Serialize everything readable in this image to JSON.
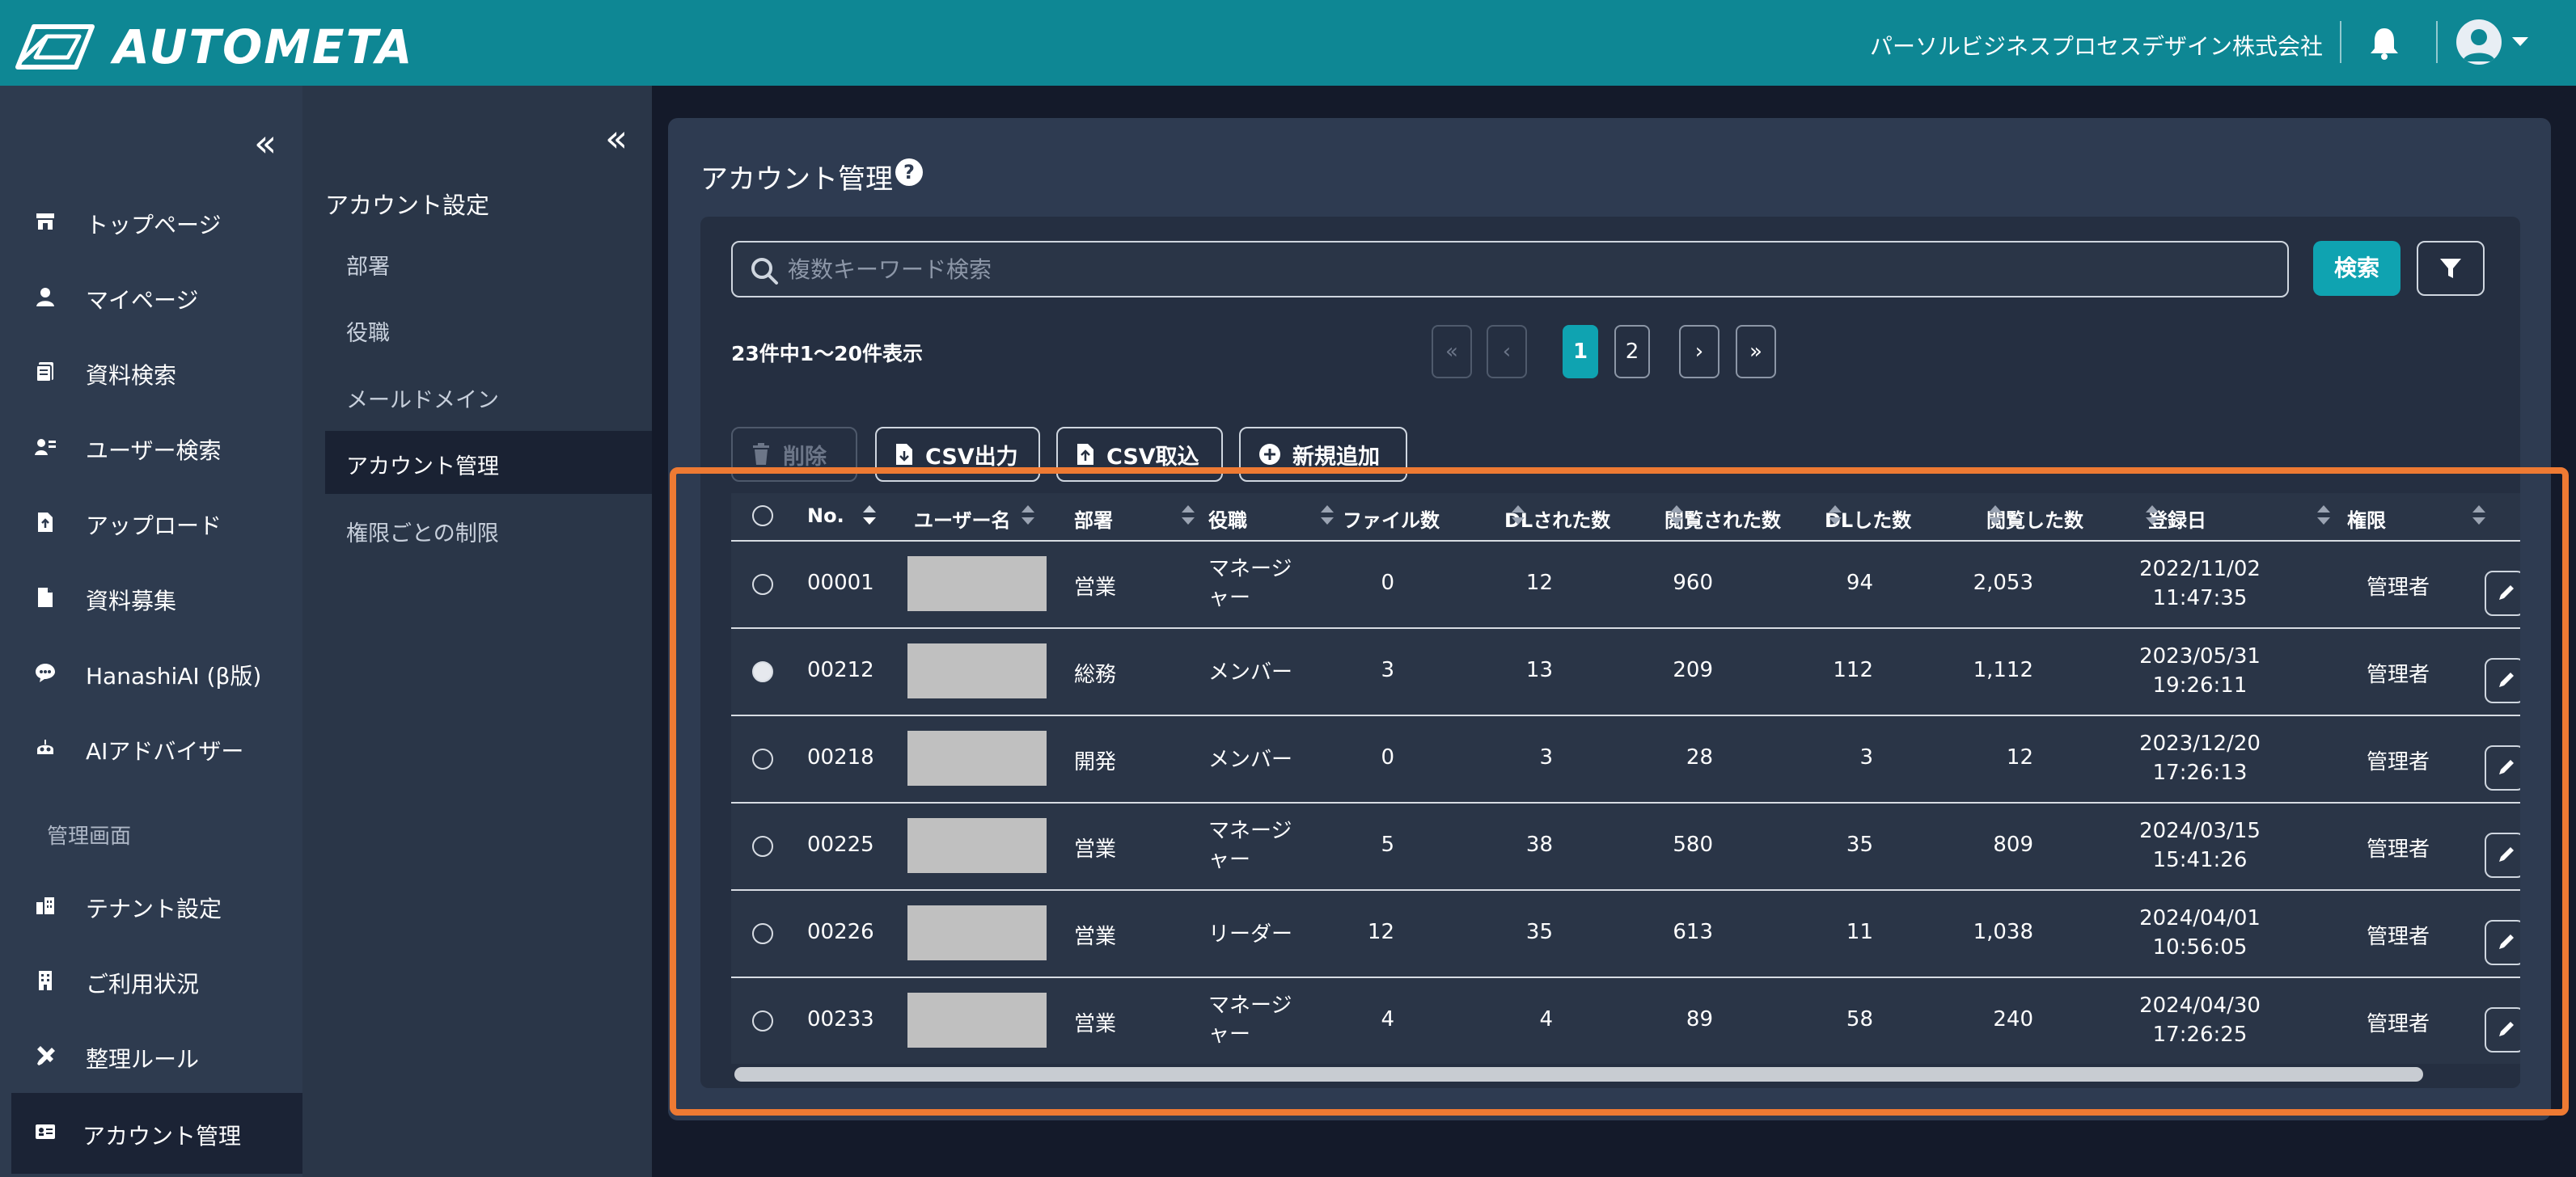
{
  "brand": {
    "name": "AUTOMETA",
    "icon": "autometa-logo-icon"
  },
  "header": {
    "company": "パーソルビジネスプロセスデザイン株式会社",
    "icons": [
      "bell-icon",
      "user-avatar-icon",
      "caret-down-icon"
    ]
  },
  "sidebar": {
    "collapse": "«",
    "items": [
      {
        "label": "トップページ",
        "icon": "store-icon"
      },
      {
        "label": "マイページ",
        "icon": "person-icon"
      },
      {
        "label": "資料検索",
        "icon": "documents-icon"
      },
      {
        "label": "ユーザー検索",
        "icon": "user-search-icon"
      },
      {
        "label": "アップロード",
        "icon": "file-upload-icon"
      },
      {
        "label": "資料募集",
        "icon": "file-icon"
      },
      {
        "label": "HanashiAI (β版)",
        "icon": "chat-icon"
      },
      {
        "label": "AIアドバイザー",
        "icon": "robot-icon"
      }
    ],
    "admin_section": "管理画面",
    "admin_items": [
      {
        "label": "テナント設定",
        "icon": "building-icon"
      },
      {
        "label": "ご利用状況",
        "icon": "office-icon"
      },
      {
        "label": "整理ルール",
        "icon": "tools-icon"
      },
      {
        "label": "アカウント管理",
        "icon": "id-card-icon",
        "active": true
      }
    ]
  },
  "subsidebar": {
    "collapse": "«",
    "title": "アカウント設定",
    "items": [
      {
        "label": "部署"
      },
      {
        "label": "役職"
      },
      {
        "label": "メールドメイン"
      },
      {
        "label": "アカウント管理",
        "active": true
      },
      {
        "label": "権限ごとの制限"
      }
    ]
  },
  "main": {
    "title": "アカウント管理",
    "help": "?",
    "search": {
      "placeholder": "複数キーワード検索",
      "value": ""
    },
    "search_button": "検索",
    "count_text": "23件中1〜20件表示",
    "pagination": {
      "first": "«",
      "prev": "‹",
      "pages": [
        "1",
        "2"
      ],
      "current": "1",
      "next": "›",
      "last": "»"
    },
    "actions": {
      "delete": "削除",
      "csv_export": "CSV出力",
      "csv_import": "CSV取込",
      "add_new": "新規追加"
    },
    "table": {
      "headers": [
        "No.",
        "ユーザー名",
        "部署",
        "役職",
        "ファイル数",
        "DLされた数",
        "閲覧された数",
        "DLした数",
        "閲覧した数",
        "登録日",
        "権限"
      ],
      "rows": [
        {
          "no": "00001",
          "dept": "営業",
          "role1": "マネージ",
          "role2": "ャー",
          "files": "0",
          "dl_by": "12",
          "viewed_by": "960",
          "dl": "94",
          "viewed": "2,053",
          "date": "2022/11/02",
          "time": "11:47:35",
          "auth": "管理者",
          "checked": false
        },
        {
          "no": "00212",
          "dept": "総務",
          "role1": "メンバー",
          "role2": "",
          "files": "3",
          "dl_by": "13",
          "viewed_by": "209",
          "dl": "112",
          "viewed": "1,112",
          "date": "2023/05/31",
          "time": "19:26:11",
          "auth": "管理者",
          "checked": true
        },
        {
          "no": "00218",
          "dept": "開発",
          "role1": "メンバー",
          "role2": "",
          "files": "0",
          "dl_by": "3",
          "viewed_by": "28",
          "dl": "3",
          "viewed": "12",
          "date": "2023/12/20",
          "time": "17:26:13",
          "auth": "管理者",
          "checked": false
        },
        {
          "no": "00225",
          "dept": "営業",
          "role1": "マネージ",
          "role2": "ャー",
          "files": "5",
          "dl_by": "38",
          "viewed_by": "580",
          "dl": "35",
          "viewed": "809",
          "date": "2024/03/15",
          "time": "15:41:26",
          "auth": "管理者",
          "checked": false
        },
        {
          "no": "00226",
          "dept": "営業",
          "role1": "リーダー",
          "role2": "",
          "files": "12",
          "dl_by": "35",
          "viewed_by": "613",
          "dl": "11",
          "viewed": "1,038",
          "date": "2024/04/01",
          "time": "10:56:05",
          "auth": "管理者",
          "checked": false
        },
        {
          "no": "00233",
          "dept": "営業",
          "role1": "マネージ",
          "role2": "ャー",
          "files": "4",
          "dl_by": "4",
          "viewed_by": "89",
          "dl": "58",
          "viewed": "240",
          "date": "2024/04/30",
          "time": "17:26:25",
          "auth": "管理者",
          "checked": false
        }
      ]
    }
  },
  "colors": {
    "topbar": "#0e8794",
    "accent": "#0fa3b1",
    "highlight": "#ee7a33",
    "sidebar": "#2e3b4f"
  }
}
